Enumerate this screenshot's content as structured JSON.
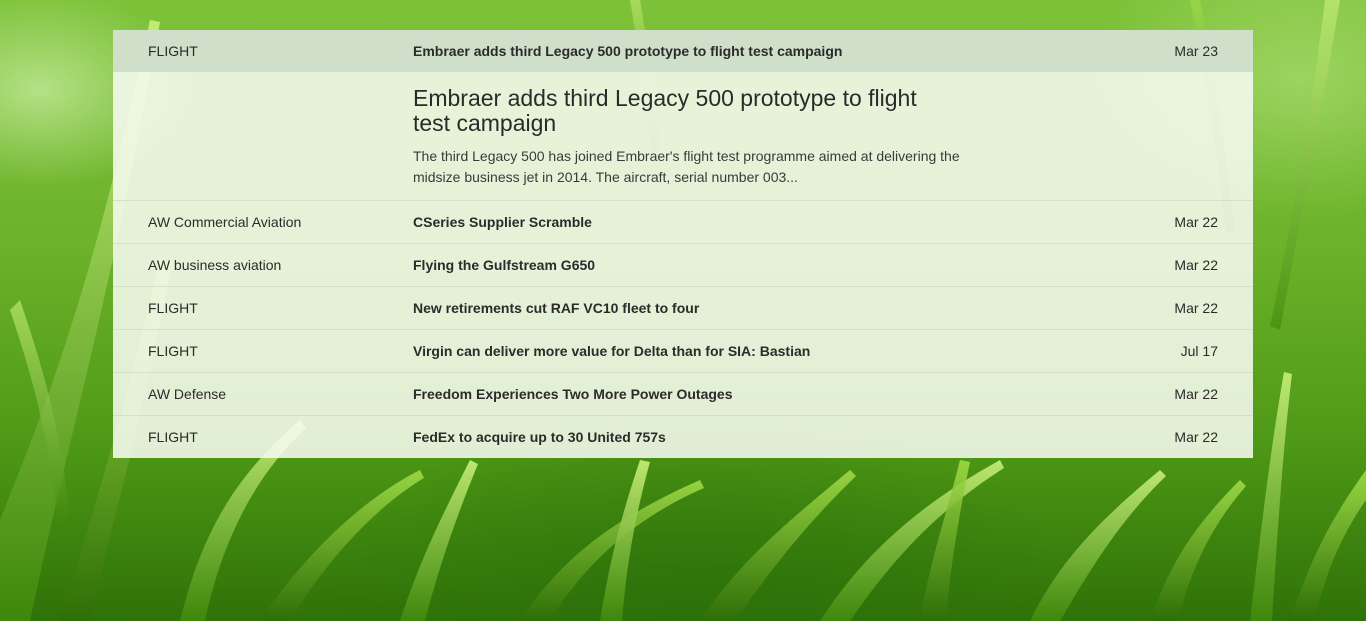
{
  "featured": {
    "source": "FLIGHT",
    "title": "Embraer adds third Legacy 500 prototype to flight test campaign",
    "date": "Mar 23",
    "headline": "Embraer adds third Legacy 500 prototype to flight test campaign",
    "summary": "The third Legacy 500 has joined Embraer's flight test programme aimed at delivering the midsize business jet in 2014. The aircraft, serial number 003..."
  },
  "items": [
    {
      "source": "AW Commercial Aviation",
      "title": "CSeries Supplier Scramble",
      "date": "Mar 22"
    },
    {
      "source": "AW business aviation",
      "title": "Flying the Gulfstream G650",
      "date": "Mar 22"
    },
    {
      "source": "FLIGHT",
      "title": "New retirements cut RAF VC10 fleet to four",
      "date": "Mar 22"
    },
    {
      "source": "FLIGHT",
      "title": "Virgin can deliver more value for Delta than for SIA: Bastian",
      "date": "Jul 17"
    },
    {
      "source": "AW Defense",
      "title": "Freedom Experiences Two More Power Outages",
      "date": "Mar 22"
    },
    {
      "source": "FLIGHT",
      "title": "FedEx to acquire up to 30 United 757s",
      "date": "Mar 22"
    }
  ]
}
